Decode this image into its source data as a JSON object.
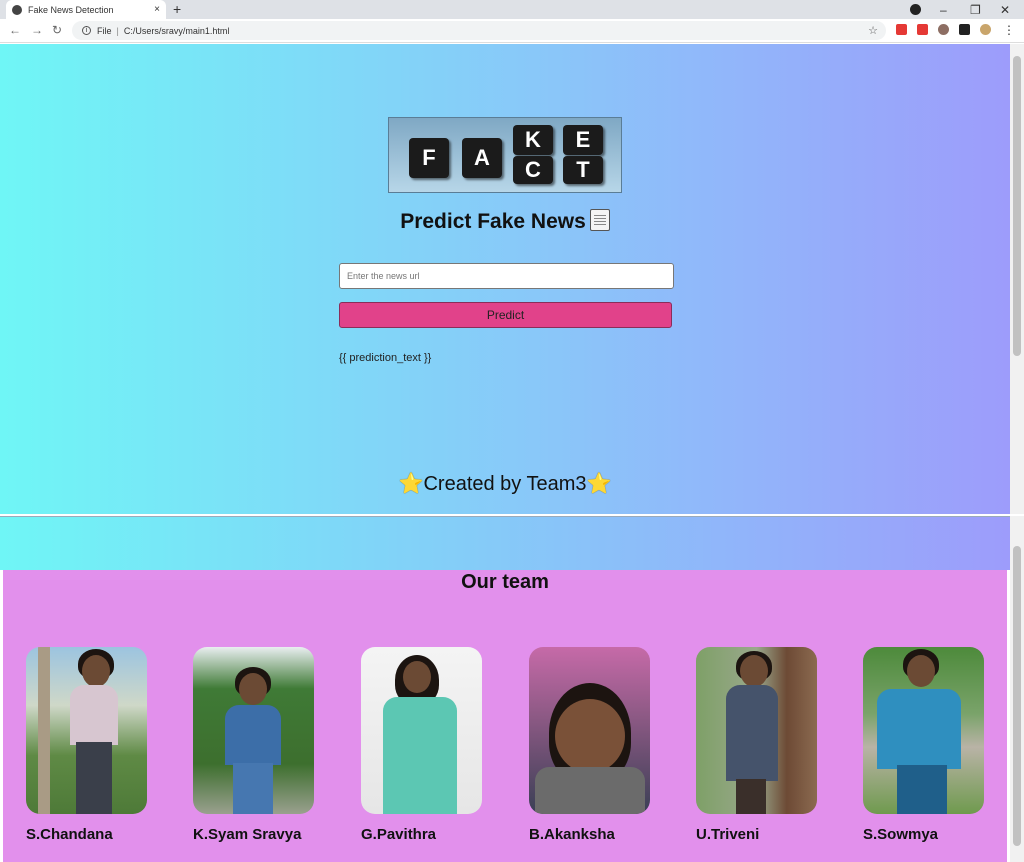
{
  "browser": {
    "tab_title": "Fake News Detection",
    "tab_close": "×",
    "new_tab": "+",
    "address_prefix": "File",
    "address_url": "C:/Users/sravy/main1.html",
    "back": "←",
    "forward": "→",
    "reload": "↻",
    "bookmark": "☆",
    "minimize": "–",
    "restore": "❐",
    "close": "✕",
    "menu": "⋮"
  },
  "logo": {
    "letters_top": [
      "F",
      "A",
      "K",
      "E"
    ],
    "letters_bottom": [
      "C",
      "T"
    ]
  },
  "heading": "Predict Fake News",
  "input": {
    "placeholder": "Enter the news url"
  },
  "predict_button": "Predict",
  "prediction_text": "{{ prediction_text }}",
  "created_by": "Created by Team3",
  "star": "⭐",
  "team": {
    "title": "Our team",
    "members": [
      {
        "name": "S.Chandana"
      },
      {
        "name": "K.Syam Sravya"
      },
      {
        "name": "G.Pavithra"
      },
      {
        "name": "B.Akanksha"
      },
      {
        "name": "U.Triveni"
      },
      {
        "name": "S.Sowmya"
      }
    ]
  },
  "colors": {
    "gradient_left": "#6ff6f6",
    "gradient_right": "#9d9cfb",
    "predict_button": "#e1428a",
    "team_background": "#e290ec"
  }
}
